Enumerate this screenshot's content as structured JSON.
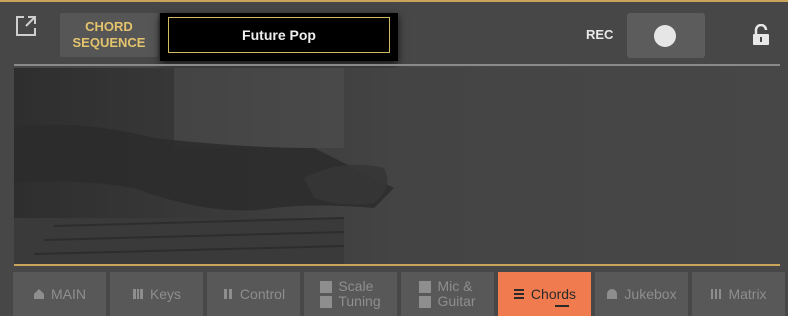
{
  "header": {
    "chord_sequence_label_line1": "CHORD",
    "chord_sequence_label_line2": "SEQUENCE",
    "title": "Future Pop",
    "rec_label": "REC",
    "rec_state": "off"
  },
  "tabs": [
    {
      "label": "MAIN",
      "icon": "home-icon"
    },
    {
      "label": "Keys",
      "icon": "keys-icon"
    },
    {
      "label": "Control",
      "icon": "control-icon"
    },
    {
      "label_line1": "Scale",
      "label_line2": "Tuning",
      "icon": "scale-icon",
      "icon2": "tuning-icon"
    },
    {
      "label_line1": "Mic &",
      "label_line2": "Guitar",
      "icon": "mic-icon",
      "icon2": "guitar-icon"
    },
    {
      "label": "Chords",
      "icon": "chords-icon",
      "active": true
    },
    {
      "label": "Jukebox",
      "icon": "jukebox-icon"
    },
    {
      "label": "Matrix",
      "icon": "matrix-icon"
    }
  ],
  "colors": {
    "accent_gold": "#c9a45a",
    "active_tab": "#f07b4f",
    "label_yellow": "#e3c46d"
  }
}
